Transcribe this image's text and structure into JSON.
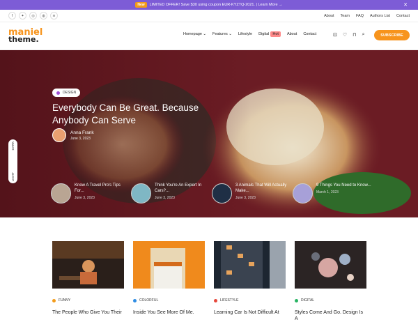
{
  "promo": {
    "badge": "New",
    "text": "LIMITED OFFER! Save $30 using coupon EUR-KYZTQ-2021. | Learn More →"
  },
  "top_links": [
    "About",
    "Team",
    "FAQ",
    "Authors List",
    "Contact"
  ],
  "logo": {
    "line1": "maniel",
    "line2": "theme."
  },
  "nav": {
    "items": [
      "Homepage ⌄",
      "Features ⌄",
      "Lifestyle",
      "Digital",
      "About",
      "Contact"
    ],
    "hot_label": "Hot",
    "subscribe": "SUBSCRIBE"
  },
  "hero": {
    "tag": "DESIGN",
    "title": "Everybody Can Be Great. Because Anybody Can Serve",
    "author": "Anna Frank",
    "date": "June 3, 2023",
    "related": [
      {
        "title": "Know A Travel Pro's Tips For...",
        "date": "June 3, 2023"
      },
      {
        "title": "Think You're An Expert In Cars?...",
        "date": "June 3, 2023"
      },
      {
        "title": "3 Animals That Will Actually Make...",
        "date": "June 3, 2023"
      },
      {
        "title": "9 Things You Need to Know...",
        "date": "March 1, 2023"
      }
    ]
  },
  "mode_toggle": {
    "dark": "DARK",
    "light": "LIGHT"
  },
  "cards": [
    {
      "category": "FUNNY",
      "color": "#f39b1a",
      "title": "The People Who Give You Their"
    },
    {
      "category": "COLORFUL",
      "color": "#2f8de4",
      "title": "Inside You See More Of Me."
    },
    {
      "category": "LIFESTYLE",
      "color": "#e6473b",
      "title": "Learning Car Is Not Difficult At"
    },
    {
      "category": "DIGITAL",
      "color": "#28b463",
      "title": "Styles Come And Go. Design Is A"
    }
  ],
  "colors": {
    "accent": "#f7941d",
    "promo_bg": "#7d5cd6",
    "hero_bg": "#6b1c24"
  }
}
